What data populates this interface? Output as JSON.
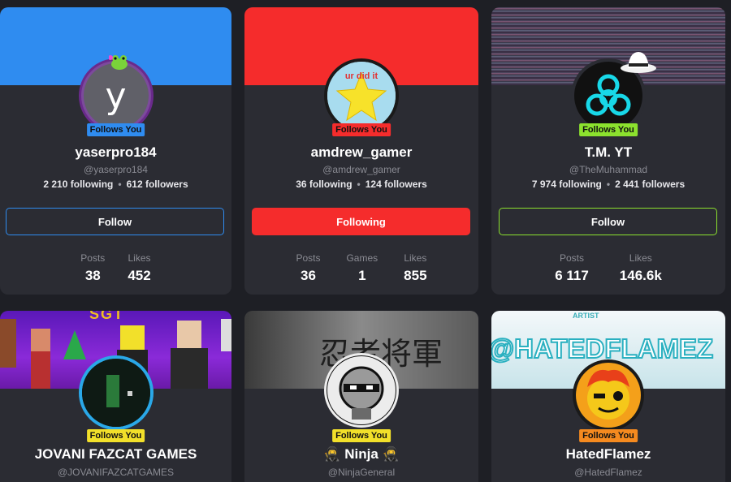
{
  "cards": [
    {
      "avatar_letter": "y",
      "badge": "Follows You",
      "name": "yaserpro184",
      "handle": "@yaserpro184",
      "following": "2 210 following",
      "followers": "612 followers",
      "button": "Follow",
      "stats": [
        {
          "label": "Posts",
          "value": "38"
        },
        {
          "label": "Likes",
          "value": "452"
        }
      ],
      "colors": {
        "banner": "#2f8cf0",
        "accent": "#2f8cf0"
      }
    },
    {
      "avatar_text": "ur did it",
      "badge": "Follows You",
      "name": "amdrew_gamer",
      "handle": "@amdrew_gamer",
      "following": "36 following",
      "followers": "124 followers",
      "button": "Following",
      "stats": [
        {
          "label": "Posts",
          "value": "36"
        },
        {
          "label": "Games",
          "value": "1"
        },
        {
          "label": "Likes",
          "value": "855"
        }
      ],
      "colors": {
        "banner": "#f52c2c",
        "accent": "#f52c2c"
      }
    },
    {
      "badge": "Follows You",
      "name": "T.M. YT",
      "handle": "@TheMuhammad",
      "following": "7 974 following",
      "followers": "2 441 followers",
      "button": "Follow",
      "stats": [
        {
          "label": "Posts",
          "value": "6 117"
        },
        {
          "label": "Likes",
          "value": "146.6k"
        }
      ],
      "colors": {
        "banner": "#3a2f45",
        "accent": "#8ce22e"
      }
    },
    {
      "banner_text": "SGT",
      "badge": "Follows You",
      "name": "JOVANI FAZCAT GAMES",
      "handle": "@JOVANIFAZCATGAMES",
      "colors": {
        "banner": "#7a22c8",
        "accent": "#f2e02a"
      }
    },
    {
      "banner_text": "忍者将軍",
      "badge": "Follows You",
      "name": "🥷 Ninja 🥷",
      "handle": "@NinjaGeneral",
      "colors": {
        "banner": "#5a5a5a",
        "accent": "#f2e02a"
      }
    },
    {
      "banner_text": "@HATEDFLAMEZ",
      "banner_subtext": "ARTIST",
      "badge": "Follows You",
      "name": "HatedFlamez",
      "handle": "@HatedFlamez",
      "colors": {
        "banner": "#dfeef0",
        "accent": "#f58a1f"
      }
    }
  ]
}
